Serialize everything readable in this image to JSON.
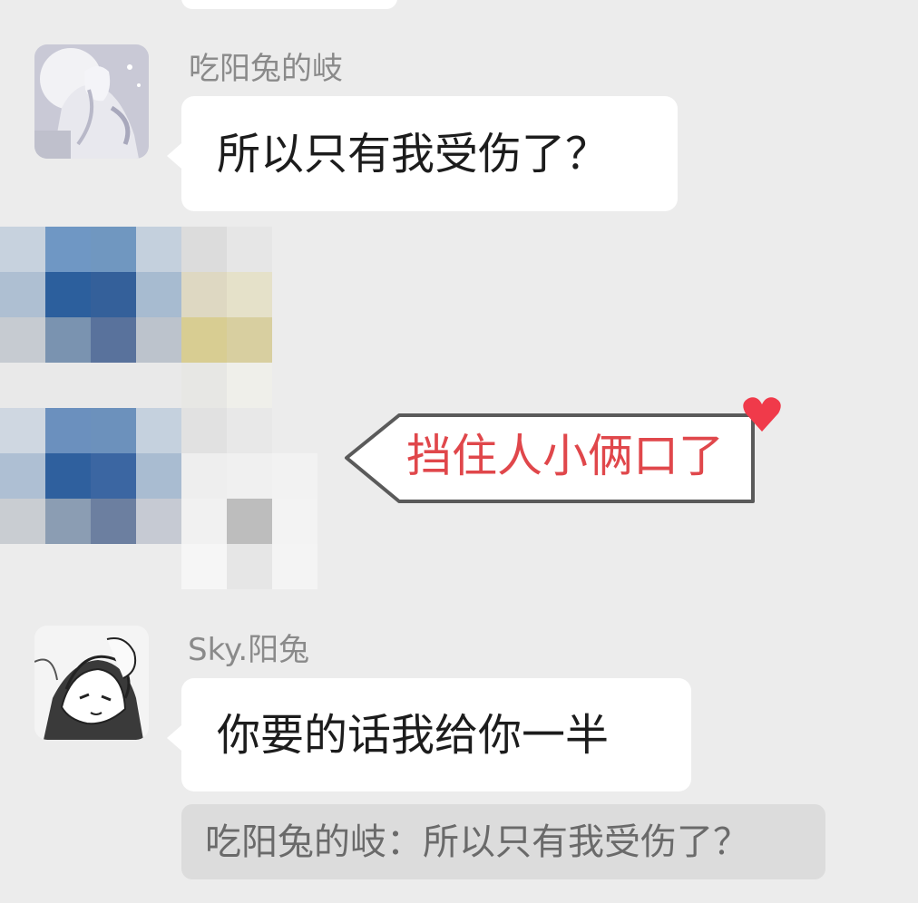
{
  "messages": [
    {
      "sender": "吃阳兔的岐",
      "text": "所以只有我受伤了？",
      "avatar": "avatar-white-haired-figure"
    },
    {
      "sender": "Sky.阳兔",
      "text": "你要的话我给你一半",
      "avatar": "avatar-manga-character",
      "quote": "吃阳兔的岐：所以只有我受伤了？"
    }
  ],
  "sticker": {
    "text": "挡住人小俩口了",
    "icon": "heart-icon",
    "color": "#e0474b"
  },
  "colors": {
    "background": "#ececec",
    "bubble": "#ffffff",
    "quote_bg": "#dcdcdc"
  }
}
